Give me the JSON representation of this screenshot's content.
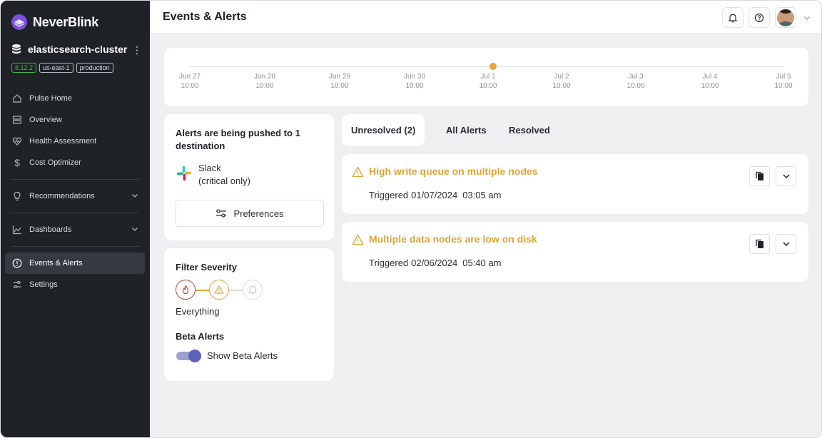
{
  "app": {
    "brand": "NeverBlink",
    "page_title": "Events & Alerts"
  },
  "cluster": {
    "name": "elasticsearch-cluster",
    "tags": [
      "8.12.2",
      "us-east-1",
      "production"
    ]
  },
  "sidebar": {
    "items": [
      {
        "label": "Pulse Home",
        "icon": "house-icon"
      },
      {
        "label": "Overview",
        "icon": "server-icon"
      },
      {
        "label": "Health Assessment",
        "icon": "heart-pulse-icon"
      },
      {
        "label": "Cost Optimizer",
        "icon": "dollar-icon"
      },
      {
        "label": "Recommendations",
        "icon": "lightbulb-icon"
      },
      {
        "label": "Dashboards",
        "icon": "chart-icon"
      },
      {
        "label": "Events & Alerts",
        "icon": "alert-circle-icon",
        "active": true
      },
      {
        "label": "Settings",
        "icon": "sliders-icon"
      }
    ]
  },
  "timeline": {
    "ticks": [
      {
        "date": "Jun 27",
        "time": "10:00"
      },
      {
        "date": "Jun 28",
        "time": "10:00"
      },
      {
        "date": "Jun 29",
        "time": "10:00"
      },
      {
        "date": "Jun 30",
        "time": "10:00"
      },
      {
        "date": "Jul 1",
        "time": "10:00"
      },
      {
        "date": "Jul 2",
        "time": "10:00"
      },
      {
        "date": "Jul 3",
        "time": "10:00"
      },
      {
        "date": "Jul 4",
        "time": "10:00"
      },
      {
        "date": "Jul 5",
        "time": "10:00"
      }
    ],
    "marker_color": "#e5a73a"
  },
  "destinations": {
    "title": "Alerts are being pushed to 1 destination",
    "slack_name": "Slack",
    "slack_scope": "(critical only)",
    "preferences_label": "Preferences"
  },
  "filter": {
    "title": "Filter Severity",
    "selected_label": "Everything",
    "beta_title": "Beta Alerts",
    "beta_toggle_label": "Show Beta Alerts",
    "beta_enabled": true,
    "colors": {
      "critical": "#c8442a",
      "warning": "#e3a534",
      "info": "#d9dbde"
    }
  },
  "tabs": [
    {
      "label": "Unresolved (2)",
      "active": true
    },
    {
      "label": "All Alerts",
      "active": false
    },
    {
      "label": "Resolved",
      "active": false
    }
  ],
  "alerts": [
    {
      "title": "High write queue on multiple nodes",
      "triggered_label": "Triggered",
      "date": "01/07/2024",
      "time": "03:05 am"
    },
    {
      "title": "Multiple data nodes are low on disk",
      "triggered_label": "Triggered",
      "date": "02/06/2024",
      "time": "05:40 am"
    }
  ]
}
